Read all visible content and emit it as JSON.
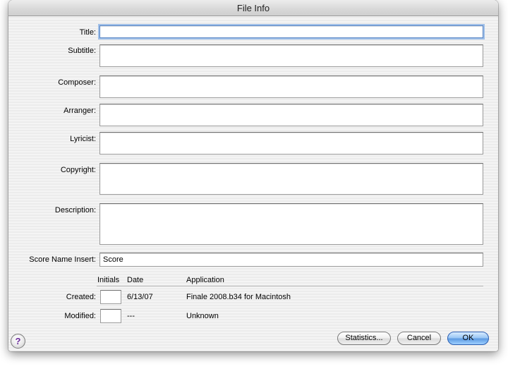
{
  "window": {
    "title": "File Info"
  },
  "form": {
    "title_label": "Title:",
    "subtitle_label": "Subtitle:",
    "composer_label": "Composer:",
    "arranger_label": "Arranger:",
    "lyricist_label": "Lyricist:",
    "copyright_label": "Copyright:",
    "description_label": "Description:",
    "score_name_insert_label": "Score Name Insert:",
    "title_value": "",
    "subtitle_value": "",
    "composer_value": "",
    "arranger_value": "",
    "lyricist_value": "",
    "copyright_value": "",
    "description_value": "",
    "score_name_insert_value": "Score"
  },
  "history": {
    "headers": {
      "initials": "Initials",
      "date": "Date",
      "application": "Application"
    },
    "rows": [
      {
        "label": "Created:",
        "initials": "",
        "date": "6/13/07",
        "application": "Finale 2008.b34 for Macintosh"
      },
      {
        "label": "Modified:",
        "initials": "",
        "date": "---",
        "application": "Unknown"
      }
    ]
  },
  "buttons": {
    "statistics": "Statistics...",
    "cancel": "Cancel",
    "ok": "OK",
    "help": "?"
  },
  "colors": {
    "focus_ring": "#9fbfe8",
    "default_button": "#5e9be3",
    "help_glyph": "#6a2a9a"
  },
  "icons": {
    "help": "help-icon"
  }
}
